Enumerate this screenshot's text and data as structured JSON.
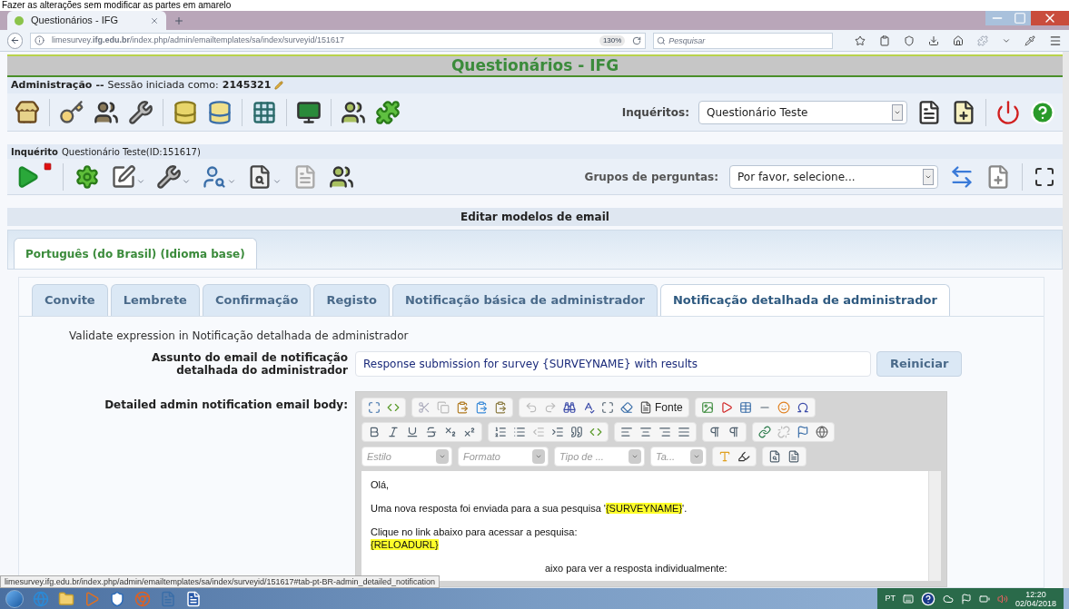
{
  "caption": "Fazer as alterações sem modificar as partes em amarelo",
  "browser": {
    "tab_title": "Questionários - IFG",
    "url": "limesurvey.**ifg.edu.br**/index.php/admin/emailtemplates/sa/index/surveyid/151617",
    "zoom": "130%",
    "search": {
      "placeholder": "Pesquisar"
    }
  },
  "page": {
    "title": "Questionários - IFG",
    "admin_bar": {
      "label": "Administração",
      "separator": "--",
      "session_text": "Sessão iniciada como:",
      "user": "2145321"
    },
    "surveys": {
      "label": "Inquéritos:",
      "value": "Questionário Teste"
    },
    "survey_bar": {
      "label": "Inquérito",
      "text": "Questionário Teste(ID:151617)"
    },
    "groups": {
      "label": "Grupos de perguntas:",
      "value": "Por favor, selecione..."
    },
    "section_title": "Editar modelos de email",
    "language_tabs": [
      {
        "label": "Português (do Brasil) (Idioma base)",
        "selected": true
      }
    ],
    "template_tabs": [
      {
        "label": "Convite",
        "selected": false
      },
      {
        "label": "Lembrete",
        "selected": false
      },
      {
        "label": "Confirmação",
        "selected": false
      },
      {
        "label": "Registo",
        "selected": false
      },
      {
        "label": "Notificação básica de administrador",
        "selected": false
      },
      {
        "label": "Notificação detalhada de administrador",
        "selected": true
      }
    ],
    "validate_text": "Validate expression in Notificação detalhada de administrador",
    "subject": {
      "label": "Assunto do email de notificação detalhada do administrador",
      "value": "Response submission for survey {SURVEYNAME} with results",
      "reset_button": "Reiniciar"
    },
    "body": {
      "label": "Detailed admin notification email body:",
      "source_button": "Fonte",
      "combos": [
        {
          "placeholder": "Estilo"
        },
        {
          "placeholder": "Formato"
        },
        {
          "placeholder": "Tipo de ..."
        },
        {
          "placeholder": "Ta..."
        }
      ],
      "paragraphs": [
        {
          "lines": [
            [
              {
                "text": "Olá,",
                "highlighted": false
              }
            ]
          ]
        },
        {
          "lines": [
            [
              {
                "text": "Uma nova resposta foi enviada para a sua pesquisa '",
                "highlighted": false
              },
              {
                "text": "{SURVEYNAME}",
                "highlighted": true
              },
              {
                "text": "'.",
                "highlighted": false
              }
            ]
          ]
        },
        {
          "lines": [
            [
              {
                "text": "Clique no link abaixo para acessar a pesquisa:",
                "highlighted": false
              }
            ],
            [
              {
                "text": "{RELOADURL}",
                "highlighted": true
              }
            ]
          ]
        },
        {
          "lines": [
            [
              {
                "text": "aixo para ver a resposta individualmente:",
                "highlighted": false
              }
            ]
          ],
          "kind": "partly_covered"
        }
      ]
    }
  },
  "status_link": "limesurvey.ifg.edu.br/index.php/admin/emailtemplates/sa/index/surveyid/151617#tab-pt-BR-admin_detailed_notification",
  "taskbar": {
    "language": "PT",
    "time": "12:20",
    "date": "02/04/2018"
  }
}
